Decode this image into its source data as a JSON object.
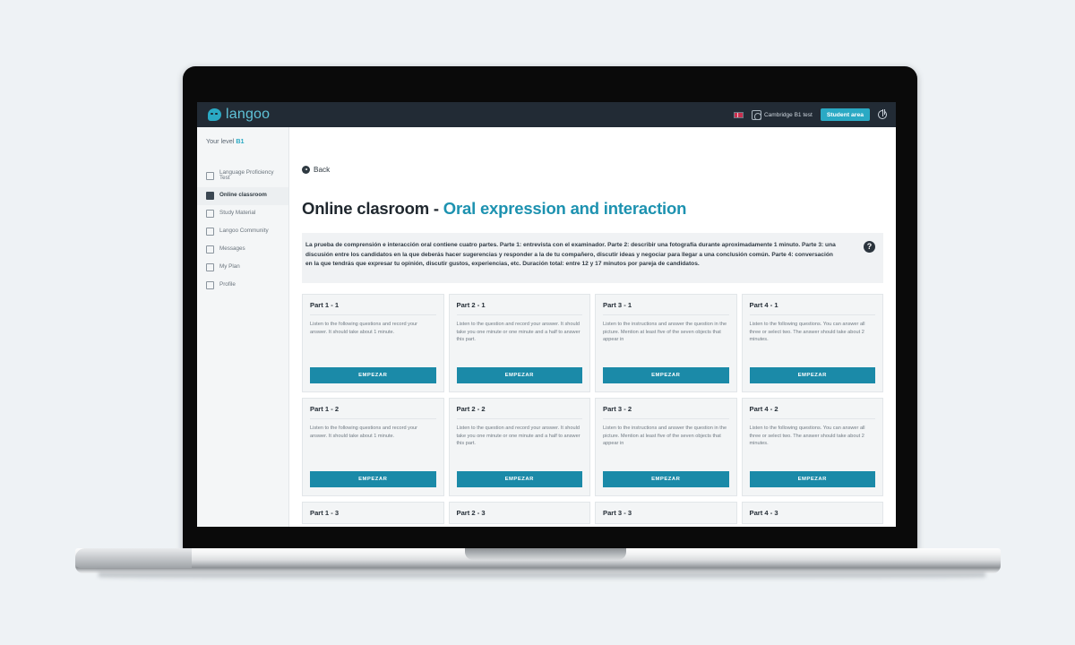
{
  "topbar": {
    "brand_name": "langoo",
    "brand_icon": "speech-bubble-icon",
    "flag_icon": "uk-flag-icon",
    "cambridge_icon": "cambridge-lock-icon",
    "cambridge_label": "Cambridge B1 test",
    "student_area_label": "Student area",
    "power_icon": "power-icon",
    "bar_color": "#222b35",
    "accent_color": "#2aa9c4"
  },
  "sidebar": {
    "level_prefix": "Your level ",
    "level_value": "B1",
    "items": [
      {
        "label": "Language Proficiency Test",
        "icon": "document-icon",
        "active": false
      },
      {
        "label": "Online classroom",
        "icon": "monitor-icon",
        "active": true
      },
      {
        "label": "Study Material",
        "icon": "book-icon",
        "active": false
      },
      {
        "label": "Langoo Community",
        "icon": "people-icon",
        "active": false
      },
      {
        "label": "Messages",
        "icon": "envelope-icon",
        "active": false
      },
      {
        "label": "My Plan",
        "icon": "card-icon",
        "active": false
      },
      {
        "label": "Profile",
        "icon": "id-card-icon",
        "active": false
      }
    ]
  },
  "main": {
    "back_label": "Back",
    "back_icon": "back-arrow-icon",
    "title_main": "Online clasroom - ",
    "title_accent": "Oral expression and interaction",
    "help_icon": "help-question-icon",
    "help_glyph": "?",
    "info_text": "La prueba de comprensión e interacción oral contiene cuatro partes. Parte 1: entrevista con el examinador. Parte 2: describir una fotografía durante aproximadamente 1 minuto. Parte 3: una discusión entre los candidatos en la que deberás hacer sugerencias y responder a la de tu compañero, discutir ideas y negociar para llegar a una conclusión común. Parte 4: conversación en la que tendrás que expresar tu opinión, discutir gustos, experiencias, etc. Duración total: entre 12 y 17 minutos por pareja de candidatos.",
    "start_button_label": "EMPEZAR",
    "descriptions": {
      "part1": "Listen to the following questions and record your answer. It should take about 1 minute.",
      "part2": "Listen to the question and record your answer. It should take you one minute or one minute and a half to answer this part.",
      "part3": "Listen to the instructions and answer the question in the picture. Mention at least five of the seven objects that appear in",
      "part4": "Listen to the following questions. You can answer all three or select two. The answer should take about 2 minutes."
    },
    "cards": [
      {
        "title": "Part 1 - 1",
        "desc_key": "part1",
        "stub": false
      },
      {
        "title": "Part 2 - 1",
        "desc_key": "part2",
        "stub": false
      },
      {
        "title": "Part 3 - 1",
        "desc_key": "part3",
        "stub": false
      },
      {
        "title": "Part 4 - 1",
        "desc_key": "part4",
        "stub": false
      },
      {
        "title": "Part 1 - 2",
        "desc_key": "part1",
        "stub": false
      },
      {
        "title": "Part 2 - 2",
        "desc_key": "part2",
        "stub": false
      },
      {
        "title": "Part 3 - 2",
        "desc_key": "part3",
        "stub": false
      },
      {
        "title": "Part 4 - 2",
        "desc_key": "part4",
        "stub": false
      },
      {
        "title": "Part 1 - 3",
        "desc_key": "part1",
        "stub": true
      },
      {
        "title": "Part 2 - 3",
        "desc_key": "part2",
        "stub": true
      },
      {
        "title": "Part 3 - 3",
        "desc_key": "part3",
        "stub": true
      },
      {
        "title": "Part 4 - 3",
        "desc_key": "part4",
        "stub": true
      }
    ],
    "button_color": "#1b8aa8",
    "accent_color": "#1d92b0"
  },
  "device": {
    "type": "laptop",
    "background_color": "#eef2f5",
    "bezel_color": "#0a0a0a"
  }
}
